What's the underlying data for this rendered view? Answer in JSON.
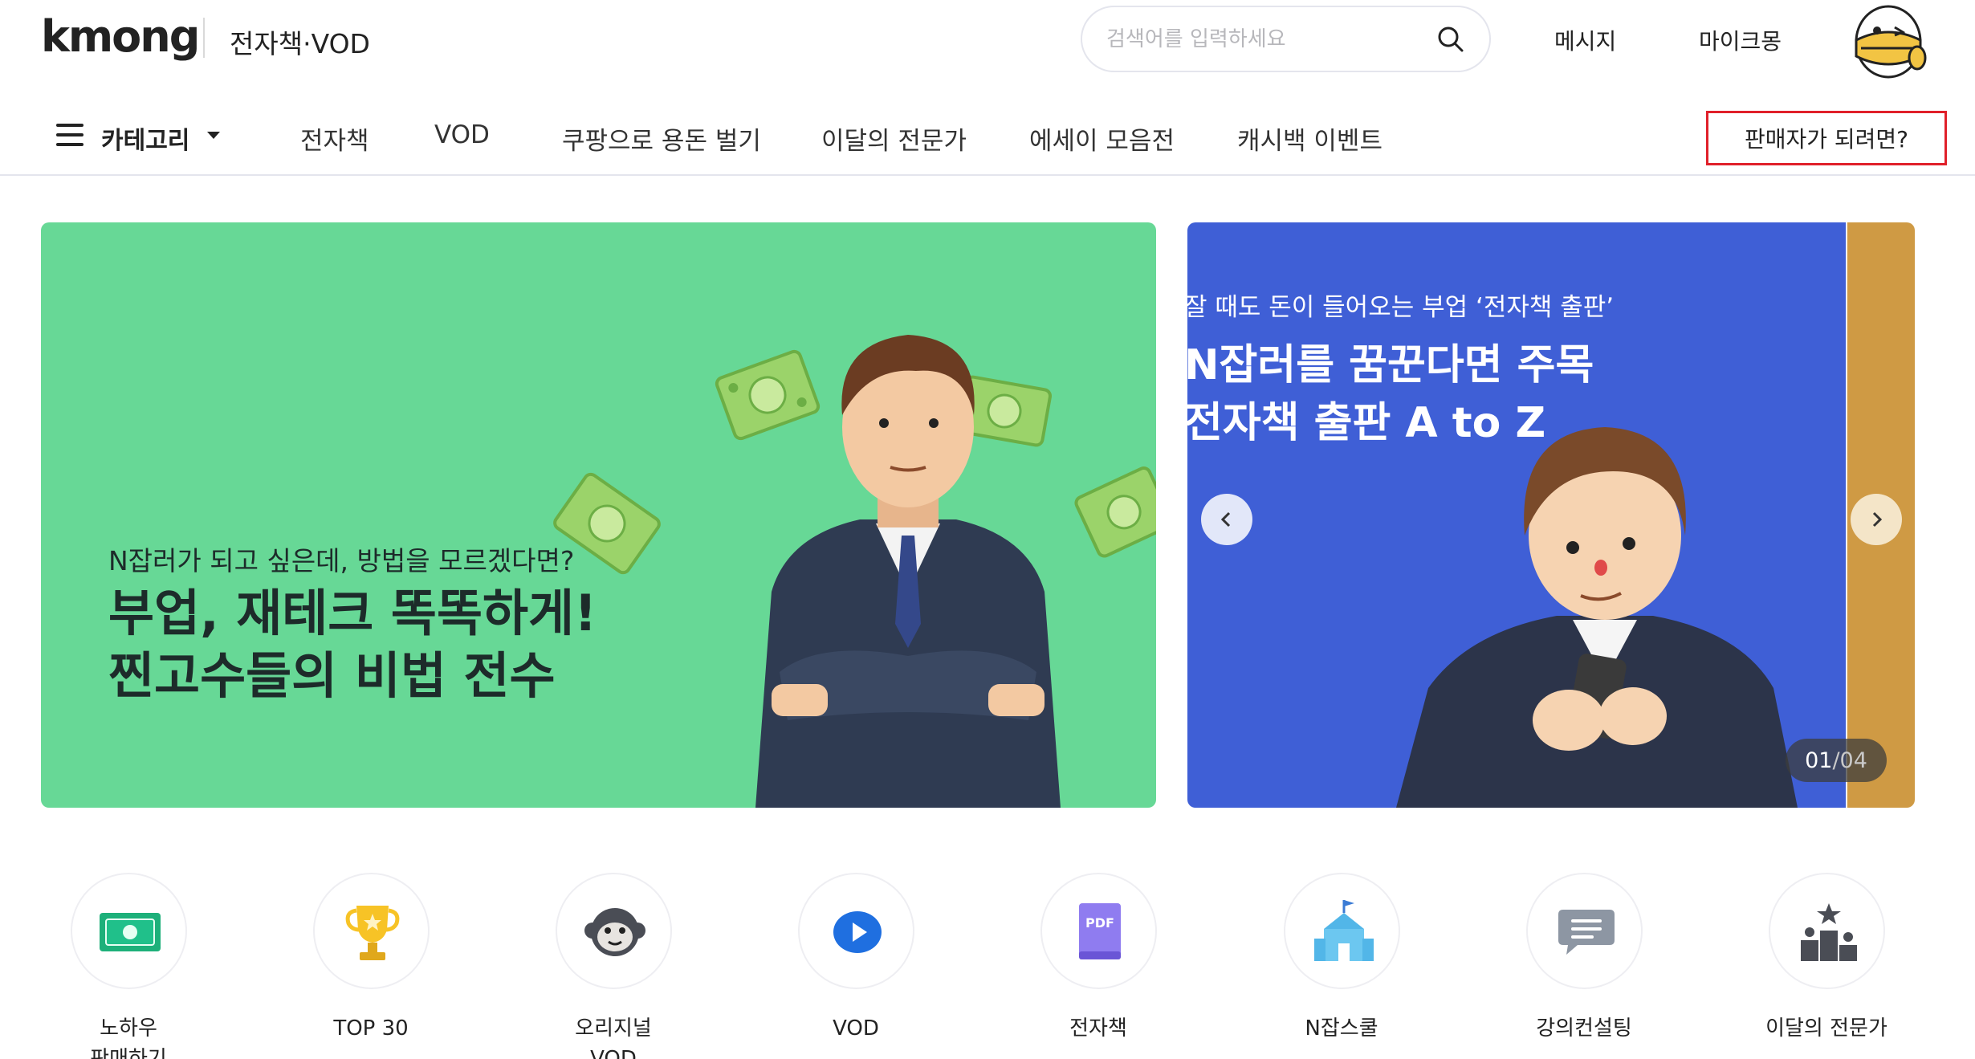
{
  "header": {
    "logo": "kmong",
    "section_title": "전자책·VOD",
    "search_placeholder": "검색어를 입력하세요",
    "links": [
      "메시지",
      "마이크몽"
    ]
  },
  "nav": {
    "category_label": "카테고리",
    "items": [
      "전자책",
      "VOD",
      "쿠팡으로 용돈 벌기",
      "이달의 전문가",
      "에세이 모음전",
      "캐시백 이벤트"
    ],
    "seller_cta": "판매자가 되려면?"
  },
  "banners": {
    "green": {
      "subtitle": "N잡러가 되고 싶은데, 방법을 모르겠다면?",
      "title": "부업, 재테크 똑똑하게!\n찐고수들의 비법 전수",
      "color": "#67d896"
    },
    "blue": {
      "subtitle": "잘 때도 돈이 들어오는 부업 ‘전자책 출판’",
      "title": "N잡러를 꿈꾼다면 주목\n전자책 출판 A to Z",
      "color": "#3f5fd6"
    },
    "next_color": "#cf9a44",
    "counter_current": "01",
    "counter_total": "/04"
  },
  "categories": [
    {
      "label": "노하우\n판매하기",
      "icon": "money-icon"
    },
    {
      "label": "TOP 30",
      "icon": "trophy-icon"
    },
    {
      "label": "오리지널\nVOD",
      "icon": "monkey-icon"
    },
    {
      "label": "VOD",
      "icon": "play-icon"
    },
    {
      "label": "전자책",
      "icon": "pdf-book-icon"
    },
    {
      "label": "N잡스쿨",
      "icon": "school-icon"
    },
    {
      "label": "강의컨설팅",
      "icon": "chat-bubble-icon"
    },
    {
      "label": "이달의 전문가",
      "icon": "podium-icon"
    }
  ]
}
